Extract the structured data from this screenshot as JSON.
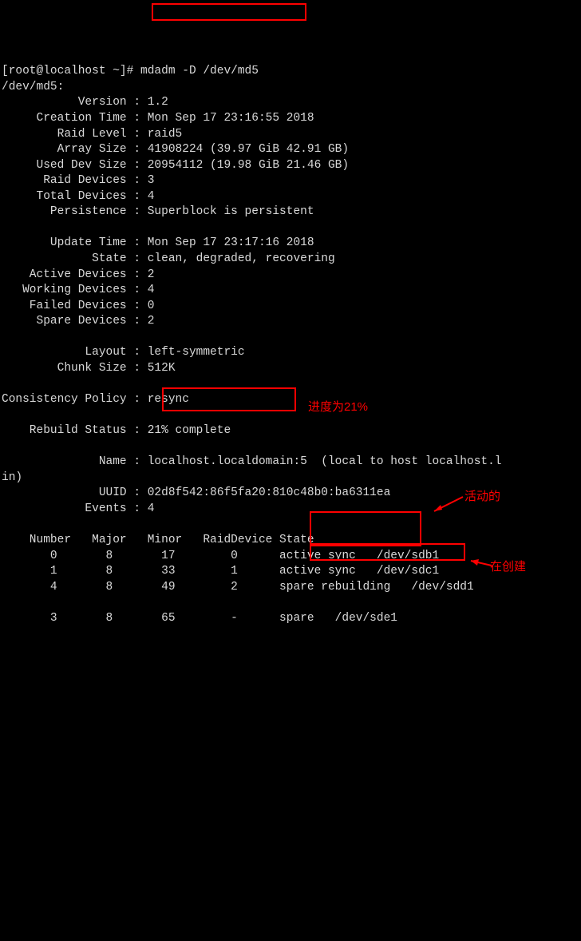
{
  "prompt_prefix": "[root@localhost ~]# ",
  "command": "mdadm -D /dev/md5",
  "output": {
    "device_line": "/dev/md5:",
    "fields": [
      {
        "label": "           Version",
        "value": "1.2"
      },
      {
        "label": "     Creation Time",
        "value": "Mon Sep 17 23:16:55 2018"
      },
      {
        "label": "        Raid Level",
        "value": "raid5"
      },
      {
        "label": "        Array Size",
        "value": "41908224 (39.97 GiB 42.91 GB)"
      },
      {
        "label": "     Used Dev Size",
        "value": "20954112 (19.98 GiB 21.46 GB)"
      },
      {
        "label": "      Raid Devices",
        "value": "3"
      },
      {
        "label": "     Total Devices",
        "value": "4"
      },
      {
        "label": "       Persistence",
        "value": "Superblock is persistent"
      },
      {
        "label": "",
        "value": ""
      },
      {
        "label": "       Update Time",
        "value": "Mon Sep 17 23:17:16 2018"
      },
      {
        "label": "             State",
        "value": "clean, degraded, recovering"
      },
      {
        "label": "    Active Devices",
        "value": "2"
      },
      {
        "label": "   Working Devices",
        "value": "4"
      },
      {
        "label": "    Failed Devices",
        "value": "0"
      },
      {
        "label": "     Spare Devices",
        "value": "2"
      },
      {
        "label": "",
        "value": ""
      },
      {
        "label": "            Layout",
        "value": "left-symmetric"
      },
      {
        "label": "        Chunk Size",
        "value": "512K"
      },
      {
        "label": "",
        "value": ""
      },
      {
        "label": "Consistency Policy",
        "value": "resync"
      },
      {
        "label": "",
        "value": ""
      },
      {
        "label": "    Rebuild Status",
        "value": "21% complete"
      },
      {
        "label": "",
        "value": ""
      },
      {
        "label": "              Name",
        "value": "localhost.localdomain:5  (local to host localhost.l"
      },
      {
        "label": "in)",
        "value": null
      },
      {
        "label": "              UUID",
        "value": "02d8f542:86f5fa20:810c48b0:ba6311ea"
      },
      {
        "label": "            Events",
        "value": "4"
      }
    ],
    "table_header": "    Number   Major   Minor   RaidDevice State",
    "table_rows": [
      "       0       8       17        0      active sync   /dev/sdb1",
      "       1       8       33        1      active sync   /dev/sdc1",
      "       4       8       49        2      spare rebuilding   /dev/sdd1",
      "",
      "       3       8       65        -      spare   /dev/sde1"
    ]
  },
  "annotations": {
    "progress_note": "进度为21%",
    "active_note": "活动的",
    "create_note": "在创建"
  }
}
